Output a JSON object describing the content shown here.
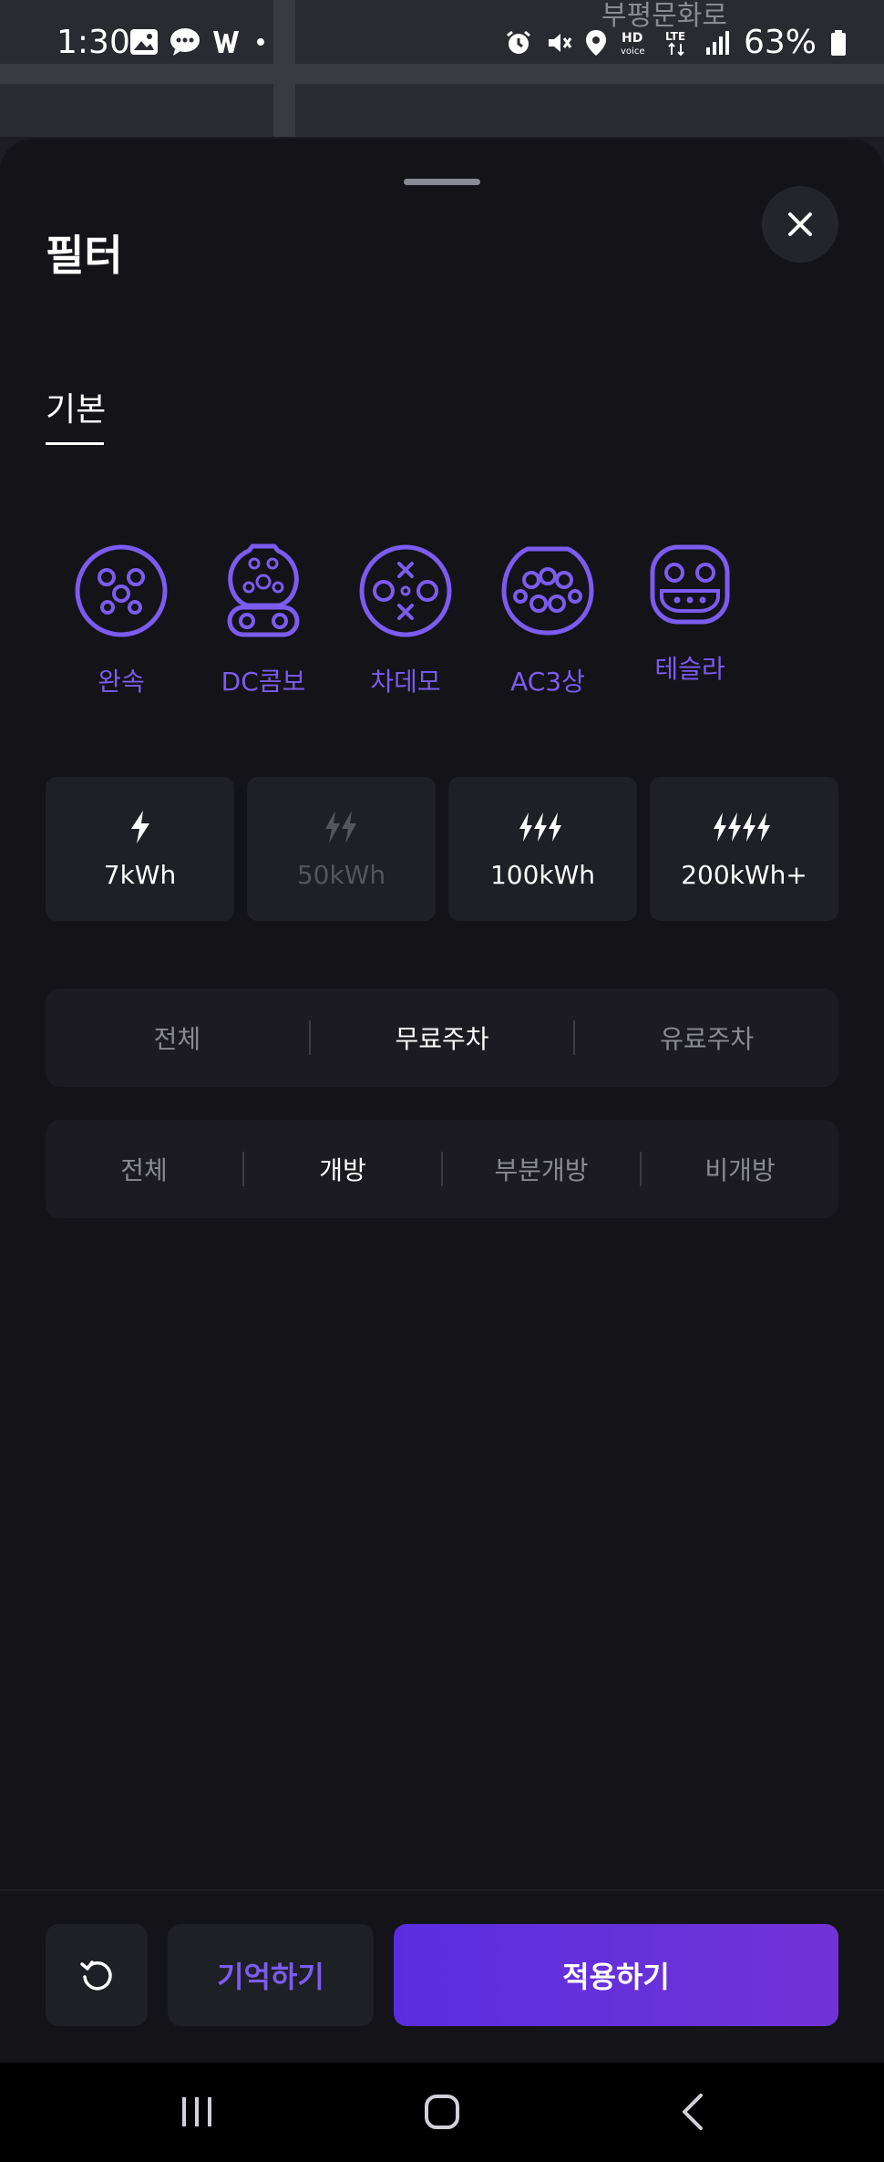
{
  "status_bar": {
    "time": "1:30",
    "battery": "63%",
    "map_labels": [
      "부평문화로"
    ],
    "icons_left": [
      "image-icon",
      "chat-icon",
      "w-icon",
      "dot-icon"
    ],
    "icons_right": [
      "alarm-icon",
      "mute-icon",
      "location-icon",
      "hd-voice-icon",
      "lte-icon",
      "signal-icon",
      "battery-icon"
    ]
  },
  "sheet": {
    "title": "필터",
    "tabs": [
      {
        "label": "기본",
        "active": true
      }
    ]
  },
  "connectors": [
    {
      "label": "완속",
      "icon": "slow-charger-icon"
    },
    {
      "label": "DC콤보",
      "icon": "dc-combo-icon"
    },
    {
      "label": "차데모",
      "icon": "chademo-icon"
    },
    {
      "label": "AC3상",
      "icon": "ac3-icon"
    },
    {
      "label": "테슬라",
      "icon": "tesla-icon"
    }
  ],
  "power_options": [
    {
      "label": "7kWh",
      "bolts": 1,
      "enabled": true
    },
    {
      "label": "50kWh",
      "bolts": 2,
      "enabled": false
    },
    {
      "label": "100kWh",
      "bolts": 3,
      "enabled": true
    },
    {
      "label": "200kWh+",
      "bolts": 4,
      "enabled": true
    }
  ],
  "parking_filter": {
    "options": [
      "전체",
      "무료주차",
      "유료주차"
    ],
    "selected": "무료주차"
  },
  "access_filter": {
    "options": [
      "전체",
      "개방",
      "부분개방",
      "비개방"
    ],
    "selected": "개방"
  },
  "actions": {
    "reset_icon": "refresh-icon",
    "save_label": "기억하기",
    "apply_label": "적용하기"
  },
  "colors": {
    "accent": "#7b5cf0",
    "apply_gradient_start": "#5a2ee0",
    "apply_gradient_end": "#7133d6",
    "sheet_bg": "#131318"
  }
}
